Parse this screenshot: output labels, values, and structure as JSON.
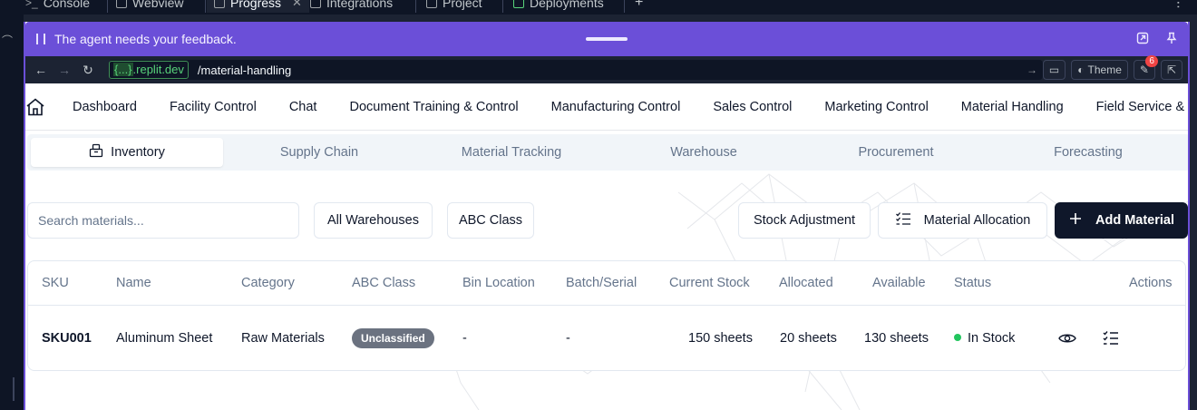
{
  "ide": {
    "tabs": [
      {
        "label": "Console"
      },
      {
        "label": "Webview"
      },
      {
        "label": "Progress"
      },
      {
        "label": "Integrations"
      },
      {
        "label": "Project"
      },
      {
        "label": "Deployments"
      }
    ]
  },
  "feedback": {
    "message": "The agent needs your feedback."
  },
  "browser": {
    "host_prefix": "{...}",
    "host_suffix": ".replit.dev",
    "path": "/material-handling",
    "theme_label": "Theme",
    "badge_count": "6"
  },
  "nav": {
    "items": [
      "Dashboard",
      "Facility Control",
      "Chat",
      "Document Training & Control",
      "Manufacturing Control",
      "Sales Control",
      "Marketing Control",
      "Material Handling",
      "Field Service & W"
    ]
  },
  "subtabs": {
    "items": [
      "Inventory",
      "Supply Chain",
      "Material Tracking",
      "Warehouse",
      "Procurement",
      "Forecasting"
    ],
    "active": "Inventory"
  },
  "toolbar": {
    "search_placeholder": "Search materials...",
    "warehouse_filter": "All Warehouses",
    "abc_filter": "ABC Class",
    "stock_adjustment": "Stock Adjustment",
    "material_allocation": "Material Allocation",
    "add_material": "Add Material"
  },
  "table": {
    "columns": [
      "SKU",
      "Name",
      "Category",
      "ABC Class",
      "Bin Location",
      "Batch/Serial",
      "Current Stock",
      "Allocated",
      "Available",
      "Status",
      "Actions"
    ],
    "rows": [
      {
        "sku": "SKU001",
        "name": "Aluminum Sheet",
        "category": "Raw Materials",
        "abc_class": "Unclassified",
        "bin_location": "-",
        "batch_serial": "-",
        "current_stock": "150 sheets",
        "allocated": "20 sheets",
        "available": "130 sheets",
        "status": "In Stock"
      }
    ]
  },
  "colors": {
    "accent": "#6b4fd8",
    "primary_button": "#0f172a",
    "status_in_stock": "#22c55e",
    "pill_unclassified": "#6b7280"
  }
}
